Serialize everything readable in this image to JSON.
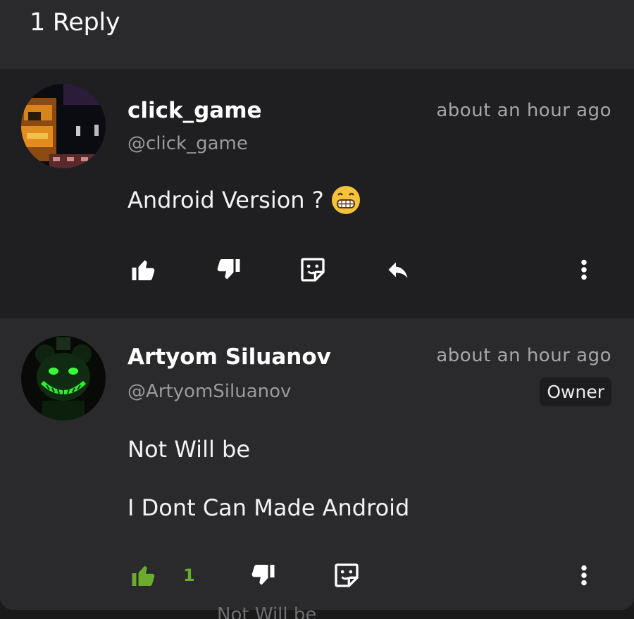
{
  "header": {
    "title": "1 Reply"
  },
  "parent_comment": {
    "author": "click_game",
    "handle": "@click_game",
    "time": "about an hour ago",
    "text": "Android Version ?",
    "emoji": "grinning-face"
  },
  "reply_comment": {
    "author": "Artyom Siluanov",
    "handle": "@ArtyomSiluanov",
    "time": "about an hour ago",
    "badge": "Owner",
    "text_line1": "Not Will be",
    "text_line2": "I Dont Can Made Android",
    "like_count": "1"
  },
  "peek_text": "Not Will be",
  "colors": {
    "background": "#1a1a1b",
    "panel": "#2a2a2d",
    "parent_bg": "#1f1f21",
    "liked_green": "#6bab2e",
    "muted_text": "#9a9a9c"
  },
  "icons": [
    "thumbs-up-icon",
    "thumbs-down-icon",
    "sticker-icon",
    "reply-arrow-icon",
    "more-vertical-icon"
  ]
}
